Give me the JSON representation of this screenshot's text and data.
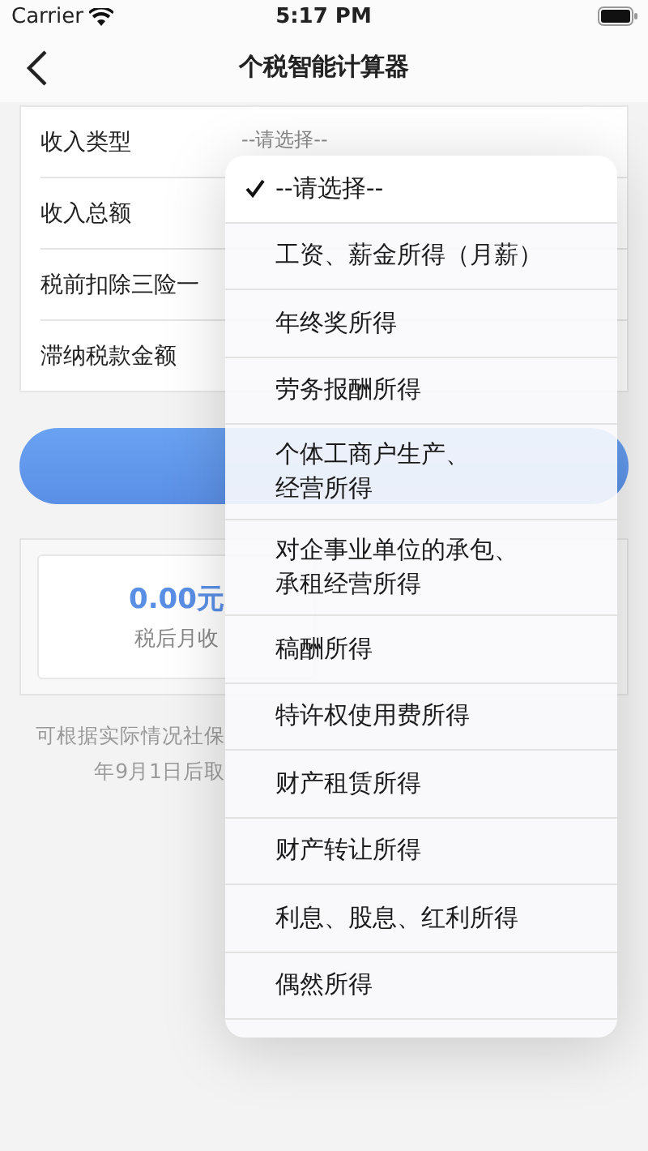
{
  "status_bar": {
    "carrier": "Carrier",
    "time": "5:17 PM"
  },
  "nav": {
    "title": "个税智能计算器"
  },
  "form": {
    "rows": [
      {
        "label": "收入类型",
        "value": "--请选择--"
      },
      {
        "label": "收入总额"
      },
      {
        "label": "税前扣除三险一"
      },
      {
        "label": "滞纳税款金额"
      }
    ]
  },
  "result": {
    "amount": "0.00元",
    "caption": "税后月收"
  },
  "note_lines": [
    "可根据实际情况社保",
    "年9月1日后取"
  ],
  "menu": {
    "items": [
      {
        "label": "--请选择--",
        "selected": true
      },
      {
        "label": "工资、薪金所得（月薪）",
        "selected": false
      },
      {
        "label": "年终奖所得",
        "selected": false
      },
      {
        "label": "劳务报酬所得",
        "selected": false
      },
      {
        "label": "个体工商户生产、经营所得",
        "selected": false
      },
      {
        "label": "对企事业单位的承包、承租经营所得",
        "selected": false
      },
      {
        "label": "稿酬所得",
        "selected": false
      },
      {
        "label": "特许权使用费所得",
        "selected": false
      },
      {
        "label": "财产租赁所得",
        "selected": false
      },
      {
        "label": "财产转让所得",
        "selected": false
      },
      {
        "label": "利息、股息、红利所得",
        "selected": false
      },
      {
        "label": "偶然所得",
        "selected": false
      }
    ]
  }
}
